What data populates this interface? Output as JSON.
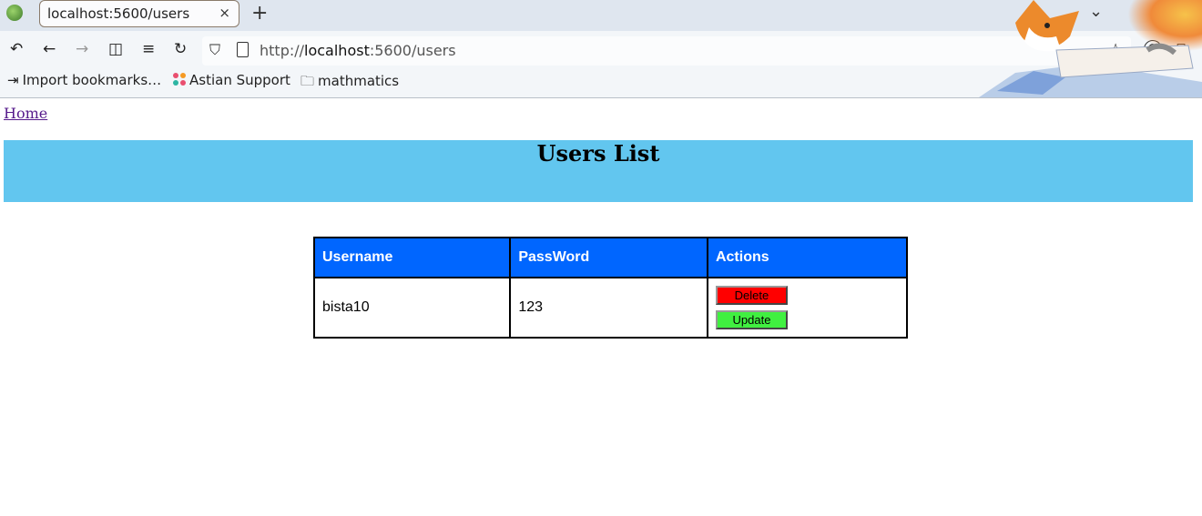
{
  "browser": {
    "tab_title": "localhost:5600/users",
    "tab_close": "×",
    "new_tab": "+",
    "url_scheme": "http://",
    "url_host": "localhost",
    "url_rest": ":5600/users",
    "bookmarks": [
      {
        "label": "Import bookmarks…",
        "icon": "import-icon"
      },
      {
        "label": "Astian Support",
        "icon": "astian-icon"
      },
      {
        "label": "mathmatics",
        "icon": "folder-icon"
      }
    ]
  },
  "page": {
    "home_link": "Home",
    "heading": "Users List",
    "banner_color": "#62c6ef",
    "header_color": "#0066ff",
    "table": {
      "columns": [
        "Username",
        "PassWord",
        "Actions"
      ],
      "rows": [
        {
          "username": "bista10",
          "password": "123",
          "delete_label": "Delete",
          "update_label": "Update"
        }
      ]
    },
    "delete_color": "#ff0000",
    "update_color": "#40f040"
  }
}
